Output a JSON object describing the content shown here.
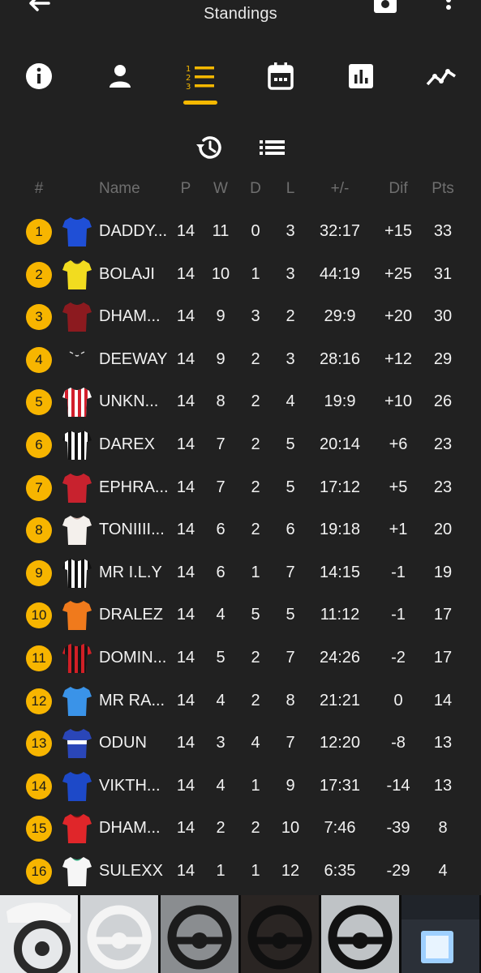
{
  "header": {
    "title": "Standings"
  },
  "icons": {
    "back": "arrow-left-icon",
    "camera": "camera-icon",
    "more": "more-vert-icon",
    "tabs": [
      "info-icon",
      "person-icon",
      "format-list-numbered-icon",
      "calendar-icon",
      "bar-chart-icon",
      "line-chart-icon"
    ],
    "history": "history-icon",
    "list": "list-icon"
  },
  "colors": {
    "accent": "#f5b800",
    "background": "#212121",
    "muted": "#6f6f6f"
  },
  "active_tab_index": 2,
  "table": {
    "columns": {
      "rank": "#",
      "name": "Name",
      "p": "P",
      "w": "W",
      "d": "D",
      "l": "L",
      "gf": "+/-",
      "dif": "Dif",
      "pts": "Pts"
    },
    "rows": [
      {
        "rank": "1",
        "name": "DADDY...",
        "p": "14",
        "w": "11",
        "d": "0",
        "l": "3",
        "gf": "32:17",
        "dif": "+15",
        "pts": "33",
        "kit": {
          "style": "solid",
          "c1": "#1f4fd6",
          "c2": "#1f4fd6"
        }
      },
      {
        "rank": "2",
        "name": "BOLAJI",
        "p": "14",
        "w": "10",
        "d": "1",
        "l": "3",
        "gf": "44:19",
        "dif": "+25",
        "pts": "31",
        "kit": {
          "style": "solid",
          "c1": "#f2dc1f",
          "c2": "#2a2a2a"
        }
      },
      {
        "rank": "3",
        "name": "DHAM...",
        "p": "14",
        "w": "9",
        "d": "3",
        "l": "2",
        "gf": "29:9",
        "dif": "+20",
        "pts": "30",
        "kit": {
          "style": "solid",
          "c1": "#8c1a1f",
          "c2": "#8c1a1f"
        }
      },
      {
        "rank": "4",
        "name": "DEEWAY",
        "p": "14",
        "w": "9",
        "d": "2",
        "l": "3",
        "gf": "28:16",
        "dif": "+12",
        "pts": "29",
        "kit": {
          "style": "blank",
          "c1": "#212121",
          "c2": "#d8d8d8"
        }
      },
      {
        "rank": "5",
        "name": "UNKN...",
        "p": "14",
        "w": "8",
        "d": "2",
        "l": "4",
        "gf": "19:9",
        "dif": "+10",
        "pts": "26",
        "kit": {
          "style": "stripes",
          "c1": "#ffffff",
          "c2": "#d21e2c"
        }
      },
      {
        "rank": "6",
        "name": "DAREX",
        "p": "14",
        "w": "7",
        "d": "2",
        "l": "5",
        "gf": "20:14",
        "dif": "+6",
        "pts": "23",
        "kit": {
          "style": "stripes",
          "c1": "#111111",
          "c2": "#ffffff"
        }
      },
      {
        "rank": "7",
        "name": "EPHRA...",
        "p": "14",
        "w": "7",
        "d": "2",
        "l": "5",
        "gf": "17:12",
        "dif": "+5",
        "pts": "23",
        "kit": {
          "style": "solid",
          "c1": "#c8222e",
          "c2": "#c8222e"
        }
      },
      {
        "rank": "8",
        "name": "TONIIII...",
        "p": "14",
        "w": "6",
        "d": "2",
        "l": "6",
        "gf": "19:18",
        "dif": "+1",
        "pts": "20",
        "kit": {
          "style": "solid",
          "c1": "#f4f0ec",
          "c2": "#c8a9a0"
        }
      },
      {
        "rank": "9",
        "name": "MR I.L.Y",
        "p": "14",
        "w": "6",
        "d": "1",
        "l": "7",
        "gf": "14:15",
        "dif": "-1",
        "pts": "19",
        "kit": {
          "style": "stripes",
          "c1": "#111111",
          "c2": "#ffffff"
        }
      },
      {
        "rank": "10",
        "name": "DRALEZ",
        "p": "14",
        "w": "4",
        "d": "5",
        "l": "5",
        "gf": "11:12",
        "dif": "-1",
        "pts": "17",
        "kit": {
          "style": "solid",
          "c1": "#f07a1c",
          "c2": "#f07a1c"
        }
      },
      {
        "rank": "11",
        "name": "DOMIN...",
        "p": "14",
        "w": "5",
        "d": "2",
        "l": "7",
        "gf": "24:26",
        "dif": "-2",
        "pts": "17",
        "kit": {
          "style": "stripes",
          "c1": "#d11f26",
          "c2": "#151515"
        }
      },
      {
        "rank": "12",
        "name": "MR RA...",
        "p": "14",
        "w": "4",
        "d": "2",
        "l": "8",
        "gf": "21:21",
        "dif": "0",
        "pts": "14",
        "kit": {
          "style": "solid",
          "c1": "#3a93e8",
          "c2": "#3a93e8"
        }
      },
      {
        "rank": "13",
        "name": "ODUN",
        "p": "14",
        "w": "3",
        "d": "4",
        "l": "7",
        "gf": "12:20",
        "dif": "-8",
        "pts": "13",
        "kit": {
          "style": "band",
          "c1": "#2a46b8",
          "c2": "#e33"
        }
      },
      {
        "rank": "14",
        "name": "VIKTH...",
        "p": "14",
        "w": "4",
        "d": "1",
        "l": "9",
        "gf": "17:31",
        "dif": "-14",
        "pts": "13",
        "kit": {
          "style": "solid",
          "c1": "#1d49c8",
          "c2": "#1d49c8"
        }
      },
      {
        "rank": "15",
        "name": "DHAM...",
        "p": "14",
        "w": "2",
        "d": "2",
        "l": "10",
        "gf": "7:46",
        "dif": "-39",
        "pts": "8",
        "kit": {
          "style": "solid",
          "c1": "#e0262a",
          "c2": "#8a1010"
        }
      },
      {
        "rank": "16",
        "name": "SULEXX",
        "p": "14",
        "w": "1",
        "d": "1",
        "l": "12",
        "gf": "6:35",
        "dif": "-29",
        "pts": "4",
        "kit": {
          "style": "solid",
          "c1": "#f6f6f6",
          "c2": "#2aa67a"
        }
      }
    ]
  },
  "ads": {
    "tiles": [
      {
        "kind": "car-steering",
        "bg": "#e6e8ea",
        "fg": "#2a2a2a"
      },
      {
        "kind": "steering-wheel",
        "bg": "#cfd2d5",
        "fg": "#f4f4f4"
      },
      {
        "kind": "steering-wheel",
        "bg": "#8a8d90",
        "fg": "#1c1c1c"
      },
      {
        "kind": "steering-wheel",
        "bg": "#2a2523",
        "fg": "#101010"
      },
      {
        "kind": "steering-wheel",
        "bg": "#bfc3c6",
        "fg": "#121212"
      },
      {
        "kind": "car-interior",
        "bg": "#20242a",
        "fg": "#9fd0ff"
      }
    ]
  }
}
